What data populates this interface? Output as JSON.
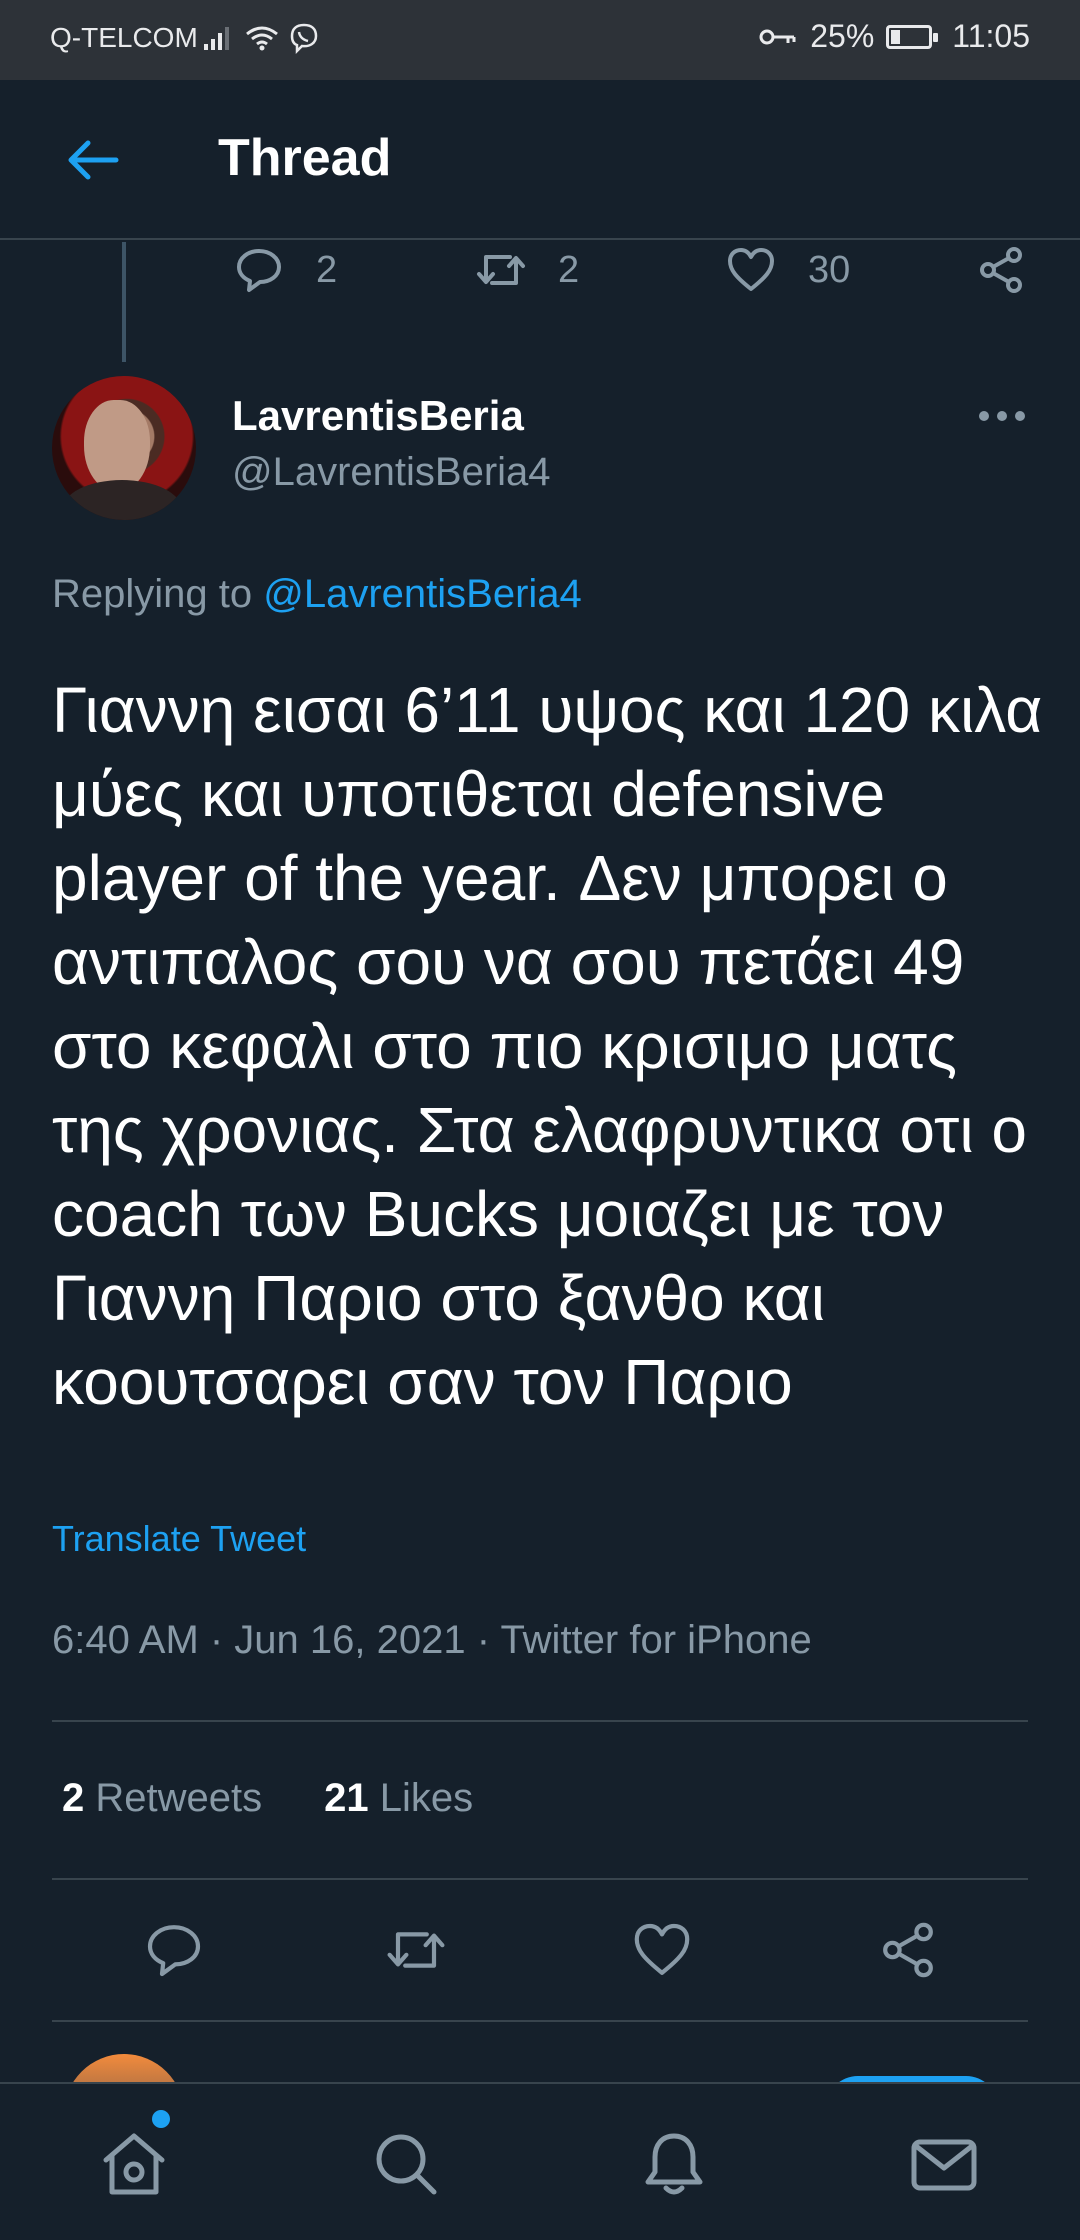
{
  "status_bar": {
    "carrier": "Q-TELCOM",
    "battery": "25%",
    "battery_level": 0.25,
    "time": "11:05"
  },
  "header": {
    "title": "Thread"
  },
  "previous_tweet_actions": {
    "replies": "2",
    "retweets": "2",
    "likes": "30"
  },
  "tweet": {
    "author_name": "LavrentisBeria",
    "author_handle": "@LavrentisBeria4",
    "replying_prefix": "Replying to",
    "replying_to": "@LavrentisBeria4",
    "text": "Γιαννη εισαι 6’11 υψος και 120 κιλα μύες και υποτιθεται defensive player of the year. Δεν μπορει ο αντιπαλος σου να σου πετάει 49 στο κεφαλι στο πιο κρισιμο ματς της χρονιας. Στα ελαφρυντικα οτι ο coach των Bucks μοιαζει με τον Γιαννη Παριο στο ξανθο και κοουτσαρει σαν τον Παριο",
    "translate_label": "Translate Tweet",
    "meta": "6:40 AM · Jun 16, 2021 · Twitter for iPhone",
    "retweets_count": "2",
    "retweets_label": "Retweets",
    "likes_count": "21",
    "likes_label": "Likes"
  },
  "colors": {
    "background": "#15202b",
    "accent": "#1da1f2",
    "secondary_text": "#8899a6"
  },
  "bottom_nav": [
    "home-icon",
    "search-icon",
    "notifications-icon",
    "messages-icon"
  ]
}
